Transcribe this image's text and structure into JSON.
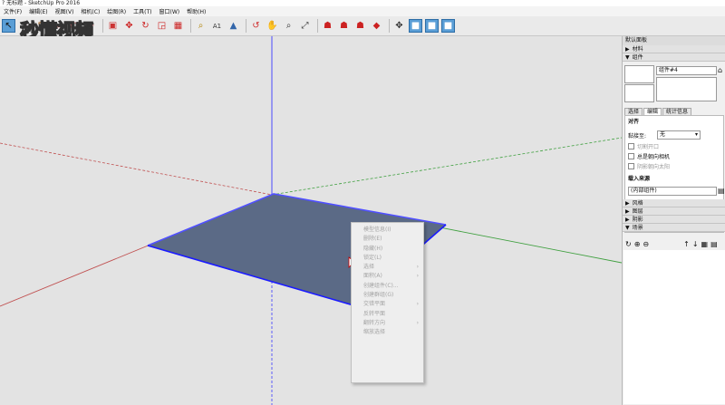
{
  "window": {
    "title": "? 无标题 - SketchUp Pro 2016"
  },
  "menu": [
    "文件(F)",
    "编辑(E)",
    "视图(V)",
    "相机(C)",
    "绘图(R)",
    "工具(T)",
    "窗口(W)",
    "帮助(H)"
  ],
  "watermark": "秒懂视频",
  "toolbar_icons": [
    "select-arrow-icon",
    "eraser-icon",
    "pencil-icon",
    "rectangle-icon",
    "circle-icon",
    "arc-icon",
    "push-pull-icon",
    "move-icon",
    "rotate-icon",
    "scale-icon",
    "offset-icon",
    "tape-measure-icon",
    "text-icon",
    "paint-bucket-icon",
    "orbit-icon",
    "pan-icon",
    "zoom-icon",
    "zoom-extents-icon",
    "warehouse-icon",
    "components-icon",
    "extension-icon",
    "ruby-icon",
    "position-camera-icon",
    "iso-view-icon",
    "top-view-icon",
    "front-view-icon"
  ],
  "panel": {
    "title": "默认面板",
    "sections": {
      "materials": "材料",
      "components": "组件",
      "styles": "风格",
      "layers": "图层",
      "shadows": "阴影",
      "scenes": "场景"
    },
    "component_name": "组件#4",
    "tabs": [
      "选择",
      "编辑",
      "统计信息"
    ],
    "align_label": "对齐",
    "glue_label": "黏接至:",
    "glue_value": "无",
    "cut_opening": "切割开口",
    "always_face_camera": "总是朝向相机",
    "shadows_face_sun": "阴影朝向太阳",
    "load_from": "载入来源",
    "internal_component": "(内部组件)"
  },
  "context_menu": [
    {
      "label": "模型信息(I)",
      "submenu": false
    },
    {
      "label": "删除(E)",
      "submenu": false
    },
    {
      "label": "隐藏(H)",
      "submenu": false
    },
    {
      "label": "锁定(L)",
      "submenu": false
    },
    {
      "label": "选择",
      "submenu": true
    },
    {
      "label": "面积(A)",
      "submenu": true
    },
    {
      "label": "创建组件(C)...",
      "submenu": false
    },
    {
      "label": "创建群组(G)",
      "submenu": false
    },
    {
      "label": "交错平面",
      "submenu": true
    },
    {
      "label": "反转平面",
      "submenu": false
    },
    {
      "label": "翻转方向",
      "submenu": true
    },
    {
      "label": "缩放选择",
      "submenu": false
    }
  ],
  "colors": {
    "face_fill": "#5b6a86",
    "edge_selected": "#1a1aff",
    "axis_red": "#c0504d",
    "axis_green": "#2e9a2e",
    "axis_blue": "#3a3aff"
  }
}
